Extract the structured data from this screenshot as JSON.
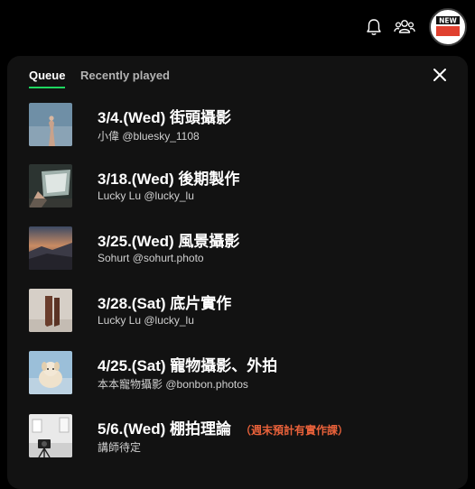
{
  "header": {
    "avatar_text": "NEW"
  },
  "tabs": [
    {
      "label": "Queue",
      "active": true
    },
    {
      "label": "Recently played",
      "active": false
    }
  ],
  "queue": [
    {
      "title": "3/4.(Wed) 街頭攝影",
      "subtitle": "小偉 @bluesky_1108",
      "note": "",
      "thumb": "street-hand"
    },
    {
      "title": "3/18.(Wed) 後期製作",
      "subtitle": "Lucky Lu @lucky_lu",
      "note": "",
      "thumb": "laptop-desk"
    },
    {
      "title": "3/25.(Wed) 風景攝影",
      "subtitle": "Sohurt @sohurt.photo",
      "note": "",
      "thumb": "landscape"
    },
    {
      "title": "3/28.(Sat) 底片實作",
      "subtitle": "Lucky Lu @lucky_lu",
      "note": "",
      "thumb": "film-boots"
    },
    {
      "title": "4/25.(Sat) 寵物攝影、外拍",
      "subtitle": "本本寵物攝影 @bonbon.photos",
      "note": "",
      "thumb": "puppy"
    },
    {
      "title": "5/6.(Wed) 棚拍理論",
      "subtitle": "講師待定",
      "note": "（週末預計有實作課）",
      "thumb": "studio-camera"
    }
  ],
  "colors": {
    "accent": "#1ed760",
    "note": "#e8613a",
    "panel": "#121212"
  }
}
